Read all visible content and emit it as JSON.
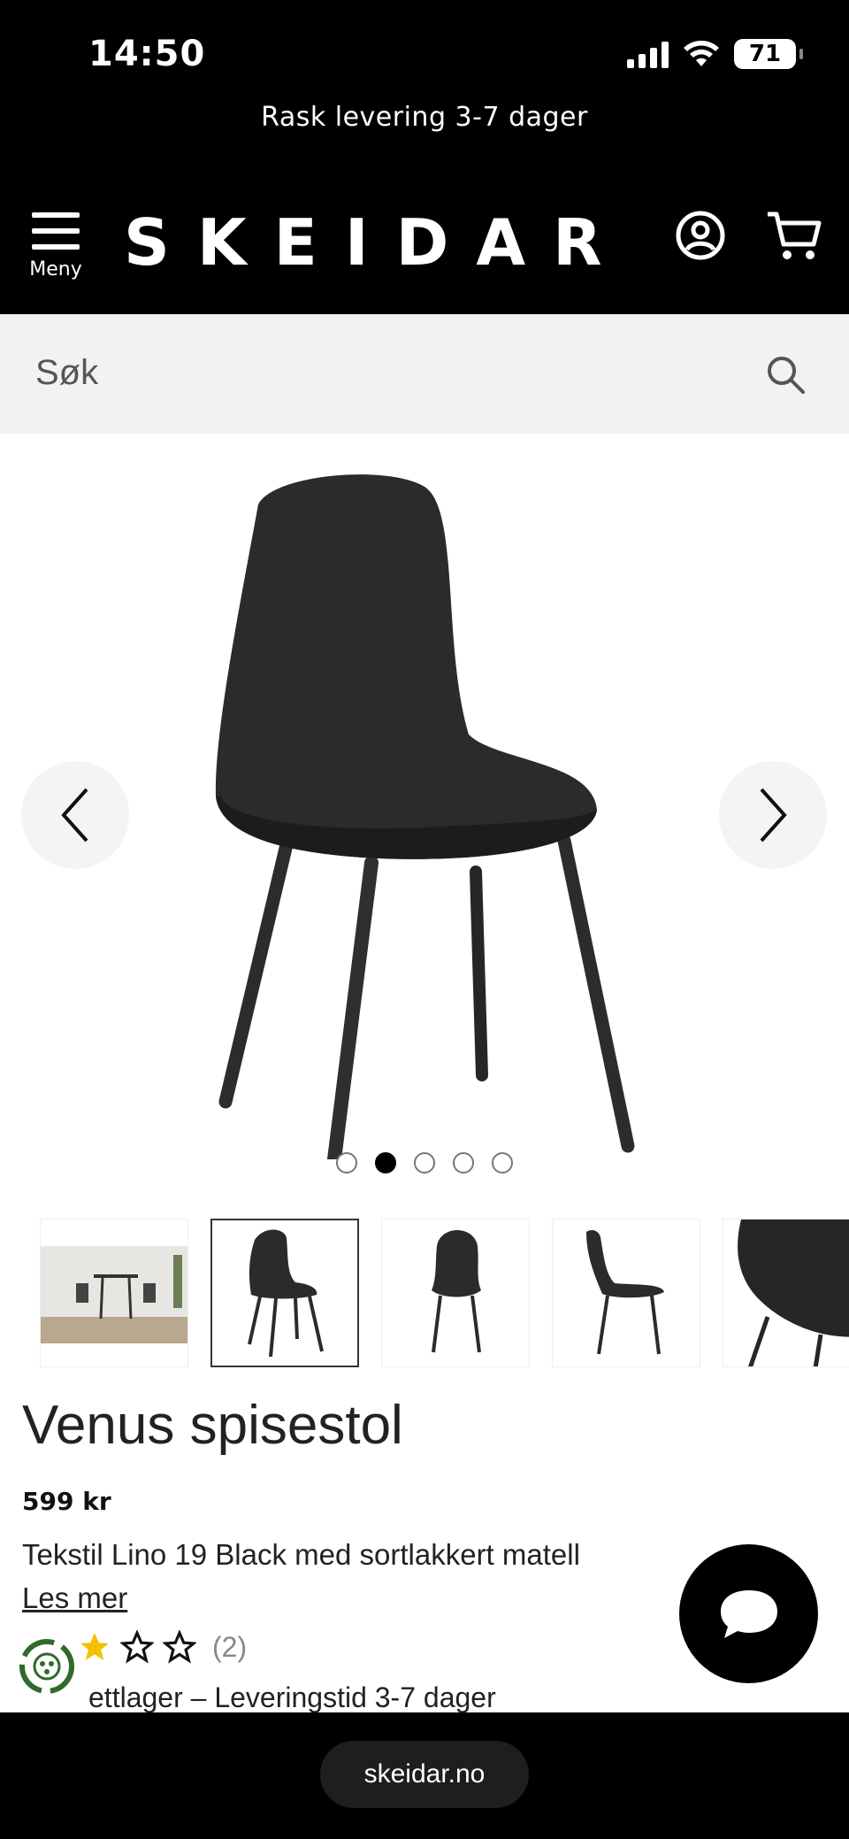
{
  "status_bar": {
    "time": "14:50",
    "battery": "71"
  },
  "promo": {
    "text": "Rask levering 3-7 dager"
  },
  "header": {
    "menu_label": "Meny",
    "logo": "SKEIDAR"
  },
  "search": {
    "placeholder": "Søk"
  },
  "gallery": {
    "image_count": 5,
    "active_index": 1
  },
  "product": {
    "title": "Venus spisestol",
    "price": "599 kr",
    "description": "Tekstil Lino 19 Black med sortlakkert matell",
    "read_more": "Les mer",
    "rating": 2,
    "rating_max": 5,
    "review_count": "(2)",
    "stock": "ettlager – Leveringstid 3-7 dager"
  },
  "browser": {
    "url": "skeidar.no"
  },
  "colors": {
    "header_bg": "#000000",
    "star": "#F2C200",
    "search_bg": "#F2F2F2"
  }
}
